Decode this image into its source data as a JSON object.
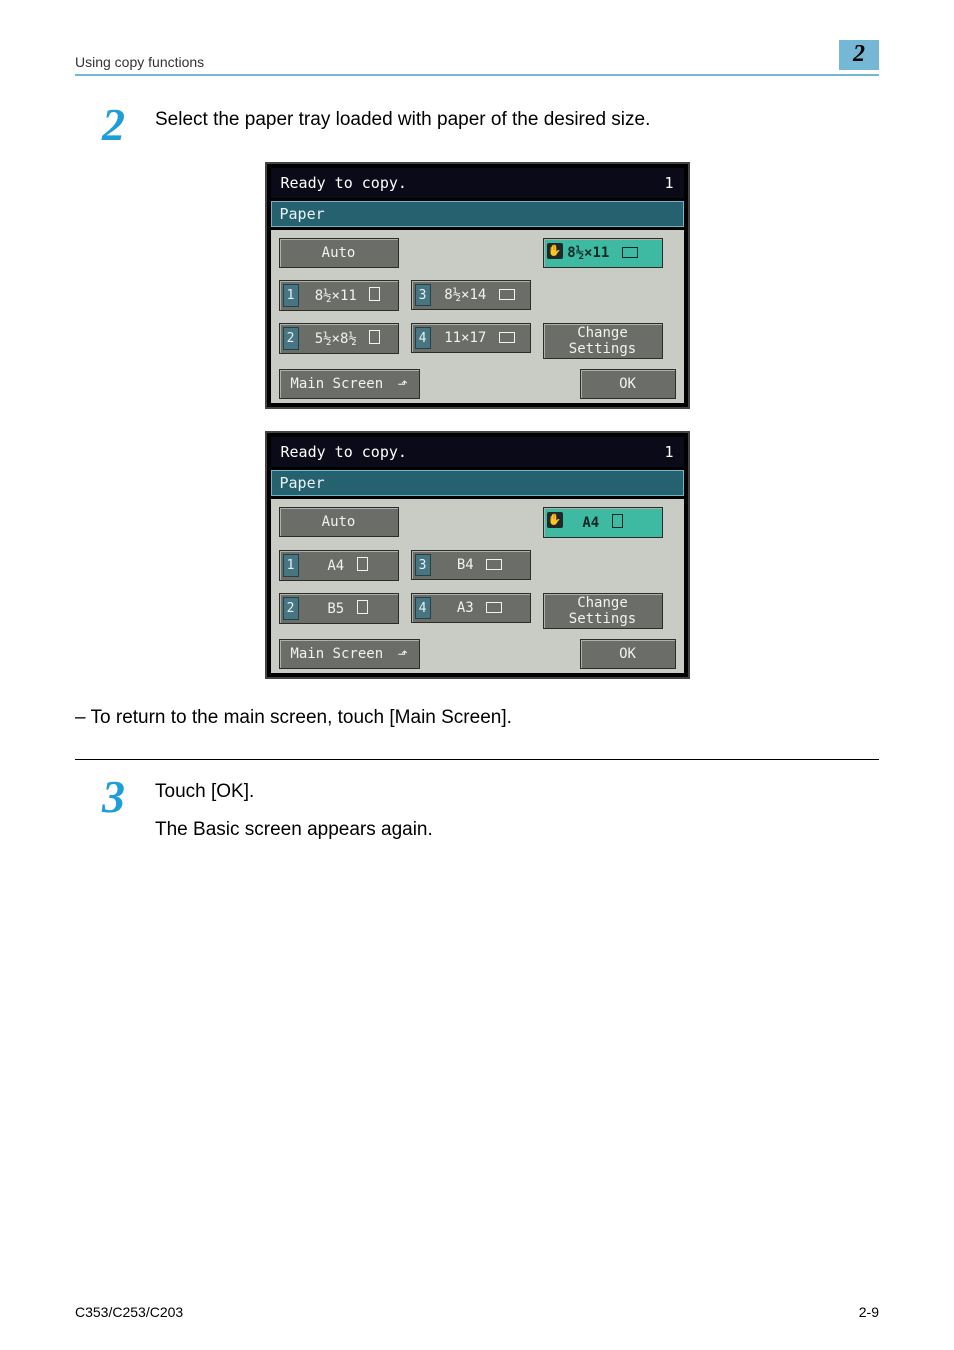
{
  "header": {
    "section": "Using copy functions",
    "chapter": "2"
  },
  "step2": {
    "num": "2",
    "text": "Select the paper tray loaded with paper of the desired size."
  },
  "screen1": {
    "status": "Ready to copy.",
    "copies": "1",
    "title": "Paper",
    "auto": "Auto",
    "selected": "8½×11",
    "tray1": "8½×11",
    "tray2": "5½×8½",
    "tray3": "8½×14",
    "tray4": "11×17",
    "change1": "Change",
    "change2": "Settings",
    "main": "Main Screen",
    "ok": "OK"
  },
  "screen2": {
    "status": "Ready to copy.",
    "copies": "1",
    "title": "Paper",
    "auto": "Auto",
    "selected": "A4",
    "tray1": "A4",
    "tray2": "B5",
    "tray3": "B4",
    "tray4": "A3",
    "change1": "Change",
    "change2": "Settings",
    "main": "Main Screen",
    "ok": "OK"
  },
  "note": "To return to the main screen, touch [Main Screen].",
  "step3": {
    "num": "3",
    "text": "Touch [OK].",
    "sub": "The Basic screen appears again."
  },
  "footer": {
    "model": "C353/C253/C203",
    "page": "2-9"
  }
}
